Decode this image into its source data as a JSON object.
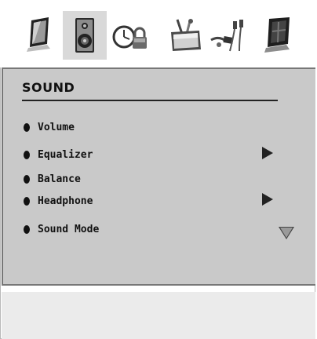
{
  "icon_tabs": [
    {
      "icon": "picture-icon"
    },
    {
      "icon": "sound-icon"
    },
    {
      "icon": "feature-icon"
    },
    {
      "icon": "install-icon"
    },
    {
      "icon": "source-icon"
    },
    {
      "icon": "settings-icon"
    }
  ],
  "menu": {
    "title": "SOUND",
    "items": [
      {
        "label": "Volume"
      },
      {
        "label": "Equalizer"
      },
      {
        "label": "Balance"
      },
      {
        "label": "Headphone"
      },
      {
        "label": "Sound Mode"
      }
    ]
  },
  "colors": {
    "panel": "#c9c9c9",
    "active_tab": "#d9d9d9",
    "text": "#111111"
  }
}
